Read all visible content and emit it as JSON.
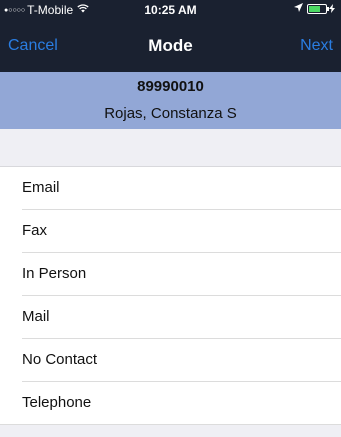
{
  "status_bar": {
    "signal_dots": "●○○○○",
    "carrier": "T-Mobile",
    "wifi_icon": "wifi-icon",
    "time": "10:25 AM",
    "location_icon": "location-arrow-icon",
    "battery_level": 0.7,
    "battery_color": "#4cd964"
  },
  "nav": {
    "cancel_label": "Cancel",
    "title": "Mode",
    "next_label": "Next",
    "accent_color": "#2a7de1",
    "bar_color": "#1a2130"
  },
  "record": {
    "id": "89990010",
    "name": "Rojas, Constanza S",
    "bg_color": "#92a7d6"
  },
  "modes": [
    {
      "label": "Email"
    },
    {
      "label": "Fax"
    },
    {
      "label": "In Person"
    },
    {
      "label": "Mail"
    },
    {
      "label": "No Contact"
    },
    {
      "label": "Telephone"
    }
  ]
}
